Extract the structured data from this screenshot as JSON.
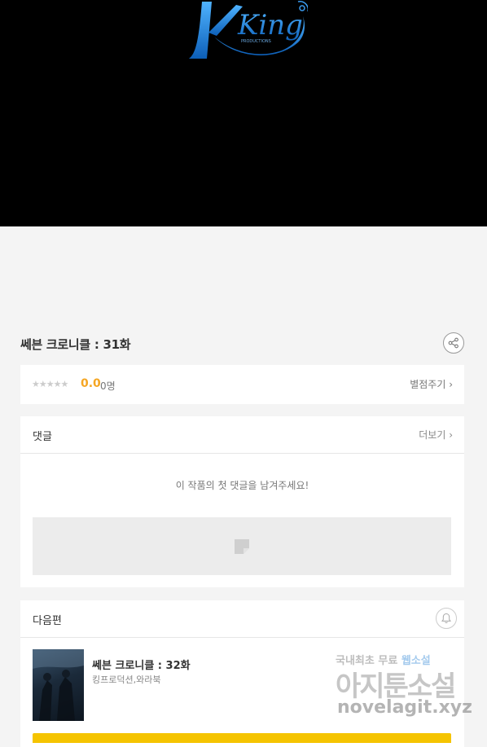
{
  "banner": {
    "logo_text": "King",
    "logo_subtext": "PRODUCTIONS"
  },
  "episode": {
    "title": "쎄븐 크로니클 : 31화"
  },
  "rating": {
    "stars": "★★★★★",
    "score": "0.0",
    "count": "0명",
    "rate_label": "별점주기 ›"
  },
  "comments": {
    "title": "댓글",
    "more_label": "더보기 ›",
    "empty_message": "이 작품의 첫 댓글을 남겨주세요!"
  },
  "next_episode": {
    "section_title": "다음편",
    "title": "쎄븐 크로니클 : 32화",
    "publisher": "킹프로덕션,와라북"
  },
  "watermark": {
    "line1_prefix": "국내최초 무료 ",
    "line1_highlight": "웹소설",
    "line2": "아지툰소설",
    "line3": "novelagit.xyz"
  },
  "colors": {
    "accent_yellow": "#f5c400",
    "score_orange": "#f5a623",
    "logo_blue": "#1e88e5"
  }
}
